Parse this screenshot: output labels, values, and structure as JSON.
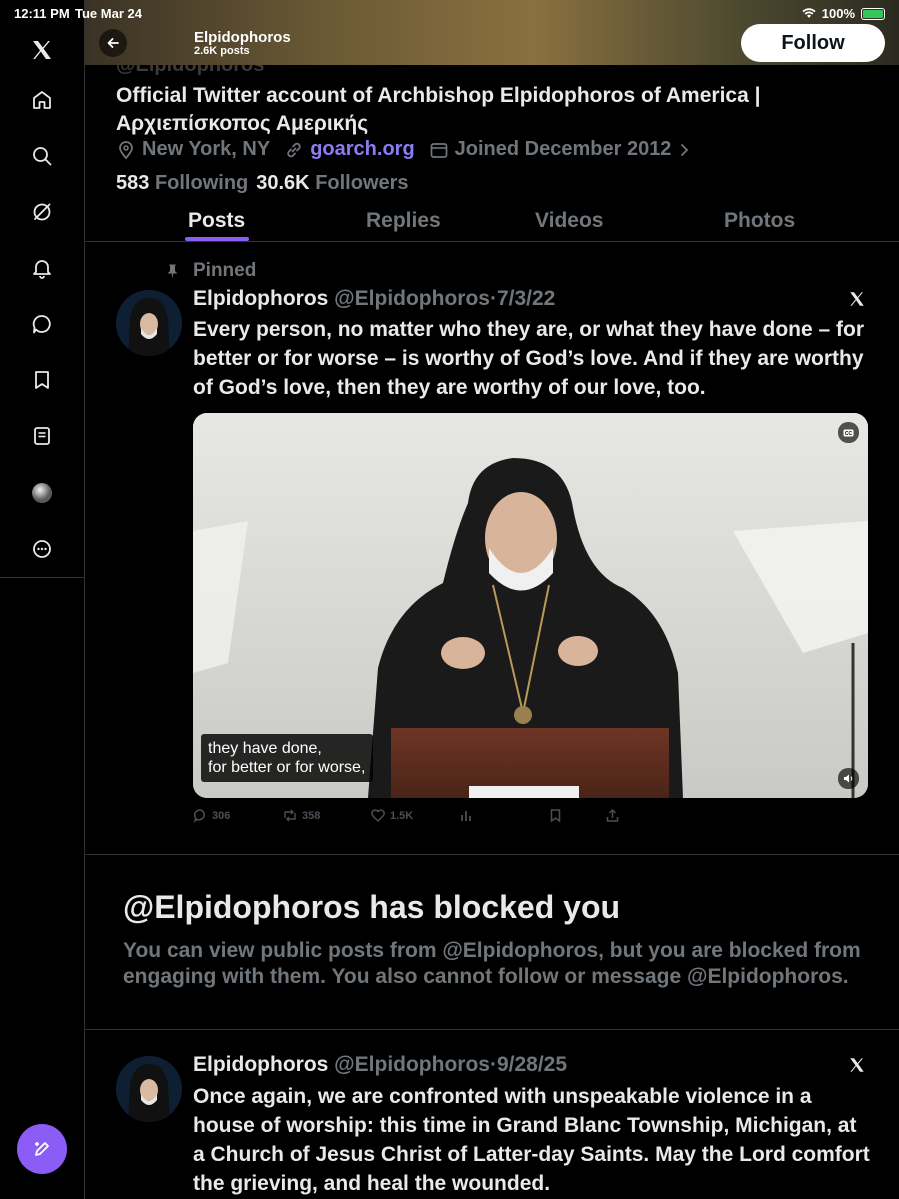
{
  "status_bar": {
    "time": "12:11 PM",
    "date": "Tue Mar 24",
    "battery": "100%"
  },
  "sidebar": {
    "items": [
      {
        "icon": "x-logo-icon"
      },
      {
        "icon": "home-icon"
      },
      {
        "icon": "search-icon"
      },
      {
        "icon": "grok-icon"
      },
      {
        "icon": "notifications-icon"
      },
      {
        "icon": "messages-icon"
      },
      {
        "icon": "bookmarks-icon"
      },
      {
        "icon": "lists-icon"
      },
      {
        "icon": "profile-avatar-icon"
      },
      {
        "icon": "more-icon"
      }
    ],
    "compose_icon": "compose-icon",
    "accent": "#8b5cf6"
  },
  "header": {
    "name": "Elpidophoros",
    "posts": "2.6K posts",
    "follow_label": "Follow"
  },
  "profile": {
    "handle": "@Elpidophoros",
    "bio": "Official Twitter account of Archbishop Elpidophoros of America | Αρχιεπίσκοπος Αμερικής",
    "location": "New York, NY",
    "website": "goarch.org",
    "joined": "Joined December 2012",
    "following_count": "583",
    "following_label": "Following",
    "followers_count": "30.6K",
    "followers_label": "Followers"
  },
  "tabs": [
    {
      "label": "Posts",
      "active": true
    },
    {
      "label": "Replies",
      "active": false
    },
    {
      "label": "Videos",
      "active": false
    },
    {
      "label": "Photos",
      "active": false
    }
  ],
  "pinned_tweet": {
    "pinned_label": "Pinned",
    "name": "Elpidophoros",
    "handle": "@Elpidophoros",
    "date": "·7/3/22",
    "text": "Every person, no matter who they are, or what they have done – for better or for worse – is worthy of God’s love. And if they are worthy of God’s love, then they are worthy of our love, too.",
    "caption_line1": "they have done,",
    "caption_line2": "for better or for worse,",
    "replies": "306",
    "reposts": "358",
    "likes": "1.5K"
  },
  "blocked": {
    "title": "@Elpidophoros has blocked you",
    "message": "You can view public posts from @Elpidophoros, but you are blocked from engaging with them. You also cannot follow or message @Elpidophoros."
  },
  "second_tweet": {
    "name": "Elpidophoros",
    "handle": "@Elpidophoros",
    "date": "·9/28/25",
    "text": "Once again, we are confronted with unspeakable violence in a house of worship: this time in Grand Blanc Township, Michigan, at a Church of Jesus Christ of Latter-day Saints. May the Lord comfort the grieving, and heal the wounded."
  }
}
